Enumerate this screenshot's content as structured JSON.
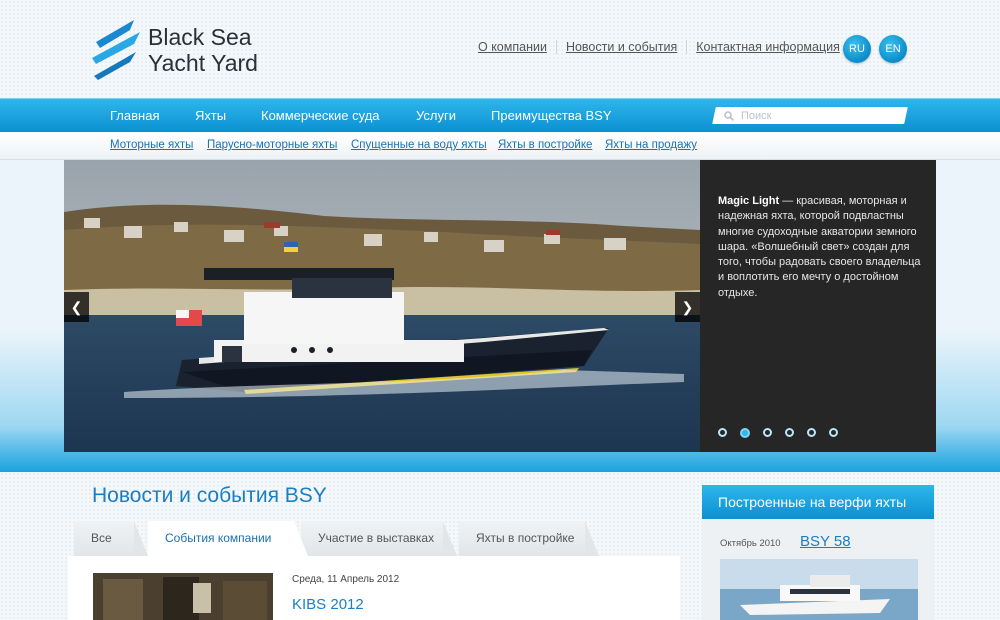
{
  "brand": {
    "name_line1": "Black Sea",
    "name_line2": "Yacht Yard",
    "colors": {
      "accent": "#0b90d2",
      "accent_light": "#2fb6ea",
      "link": "#1574b5",
      "panel": "#262626"
    }
  },
  "top_links": [
    "О компании",
    "Новости и события",
    "Контактная информация"
  ],
  "languages": [
    "RU",
    "EN"
  ],
  "main_nav": [
    "Главная",
    "Яхты",
    "Коммерческие суда",
    "Услуги",
    "Преимущества BSY"
  ],
  "search": {
    "placeholder": "Поиск",
    "icon": "search-icon"
  },
  "sub_nav": [
    "Моторные яхты",
    "Парусно-моторные яхты",
    "Спущенные на воду яхты",
    "Яхты в постройке",
    "Яхты на продажу"
  ],
  "slider": {
    "caption_bold": "Magic Light",
    "caption_text": " — красивая, моторная и надежная яхта, которой подвластны многие судоходные акватории земного шара. «Волшебный свет» создан для того, чтобы радовать своего владельца и воплотить его мечту о достойном отдыхе.",
    "dots_count": 6,
    "active_dot": 1,
    "prev_icon": "chevron-left-icon",
    "next_icon": "chevron-right-icon"
  },
  "news": {
    "title": "Новости и события BSY",
    "tabs": [
      "Все",
      "События компании",
      "Участие в выставках",
      "Яхты в постройке"
    ],
    "active_tab": 1,
    "item": {
      "date": "Среда, 11 Апрель 2012",
      "headline": "KIBS 2012"
    }
  },
  "sidebar": {
    "title": "Построенные на верфи яхты",
    "date": "Октябрь 2010",
    "link": "BSY 58"
  }
}
